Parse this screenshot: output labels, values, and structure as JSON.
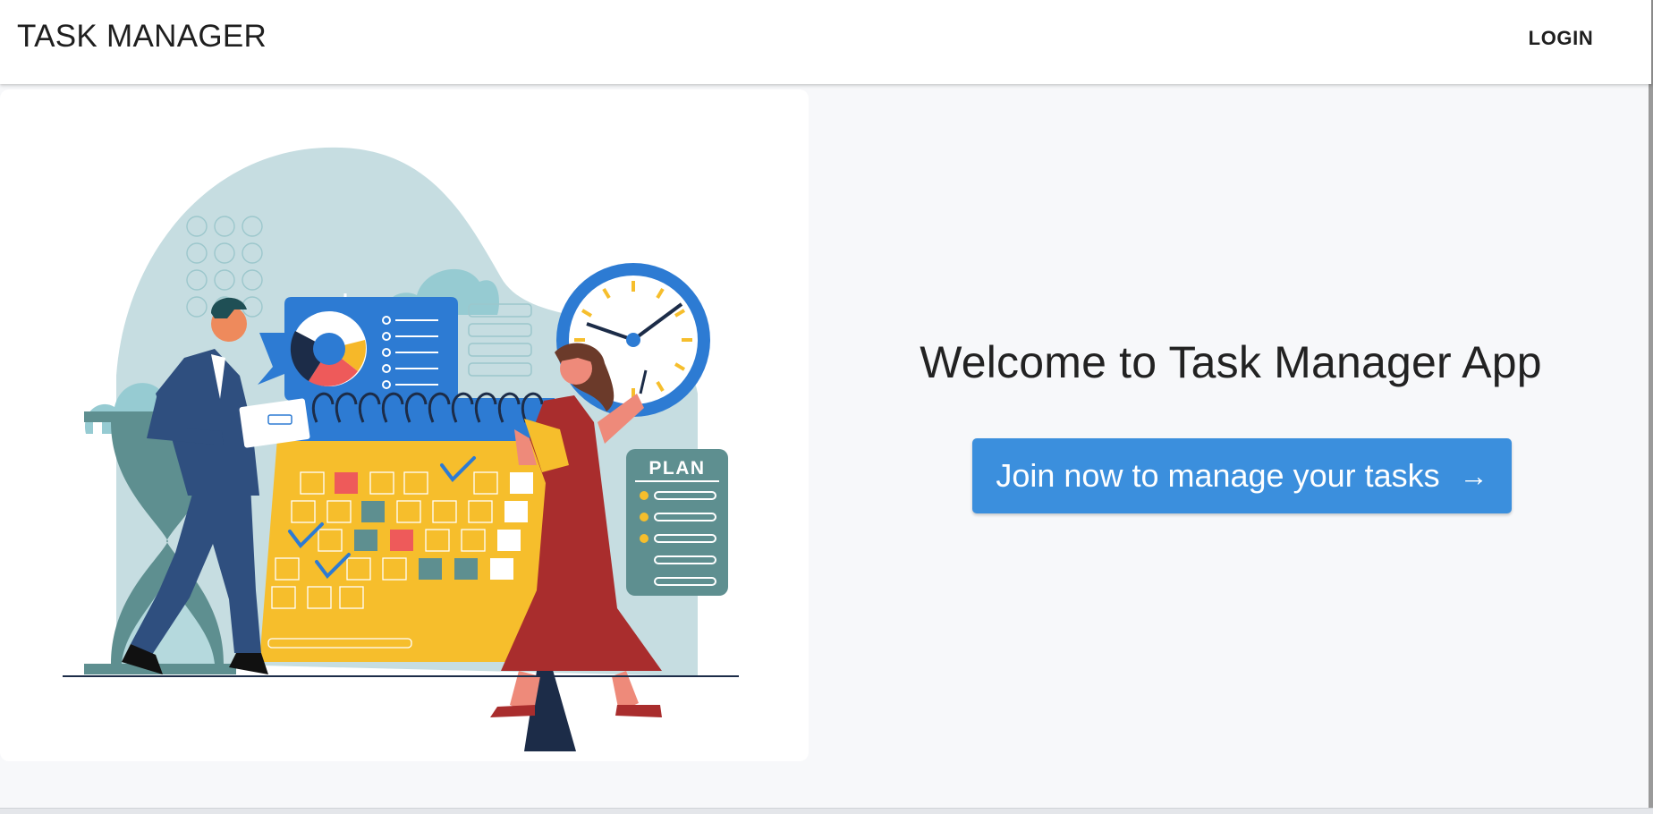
{
  "header": {
    "title": "TASK MANAGER",
    "login_label": "LOGIN"
  },
  "hero": {
    "welcome_text": "Welcome to Task Manager App",
    "cta_label": "Join now to manage your tasks",
    "cta_icon": "arrow-right-icon"
  },
  "illustration": {
    "plan_label": "PLAN",
    "icons": [
      "person-man-icon",
      "person-woman-icon",
      "calendar-icon",
      "clock-icon",
      "hourglass-icon",
      "pie-chart-icon",
      "cloud-icon",
      "plan-checklist-icon"
    ]
  },
  "colors": {
    "accent": "#3b8fdd",
    "header_bg": "#ffffff",
    "page_bg": "#f7f8fa"
  }
}
